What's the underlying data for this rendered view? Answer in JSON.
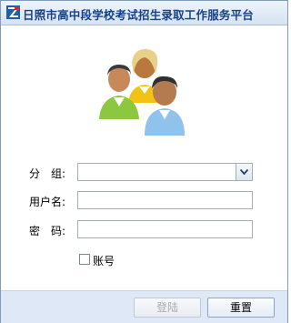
{
  "window": {
    "title": "日照市高中段学校考试招生录取工作服务平台"
  },
  "form": {
    "group_label": "分　组:",
    "group_value": "",
    "username_label": "用户名:",
    "username_value": "",
    "password_label": "密　码:",
    "password_value": "",
    "account_checkbox_label": "账号",
    "account_checked": false
  },
  "buttons": {
    "login_label": "登陆",
    "login_enabled": false,
    "reset_label": "重置"
  },
  "icons": {
    "logo": "logo-icon",
    "users": "users-group-icon",
    "dropdown": "chevron-down-icon"
  },
  "colors": {
    "title_text": "#15428b",
    "footer_bg": "#dfe8f6",
    "field_border": "#a5acb5"
  }
}
